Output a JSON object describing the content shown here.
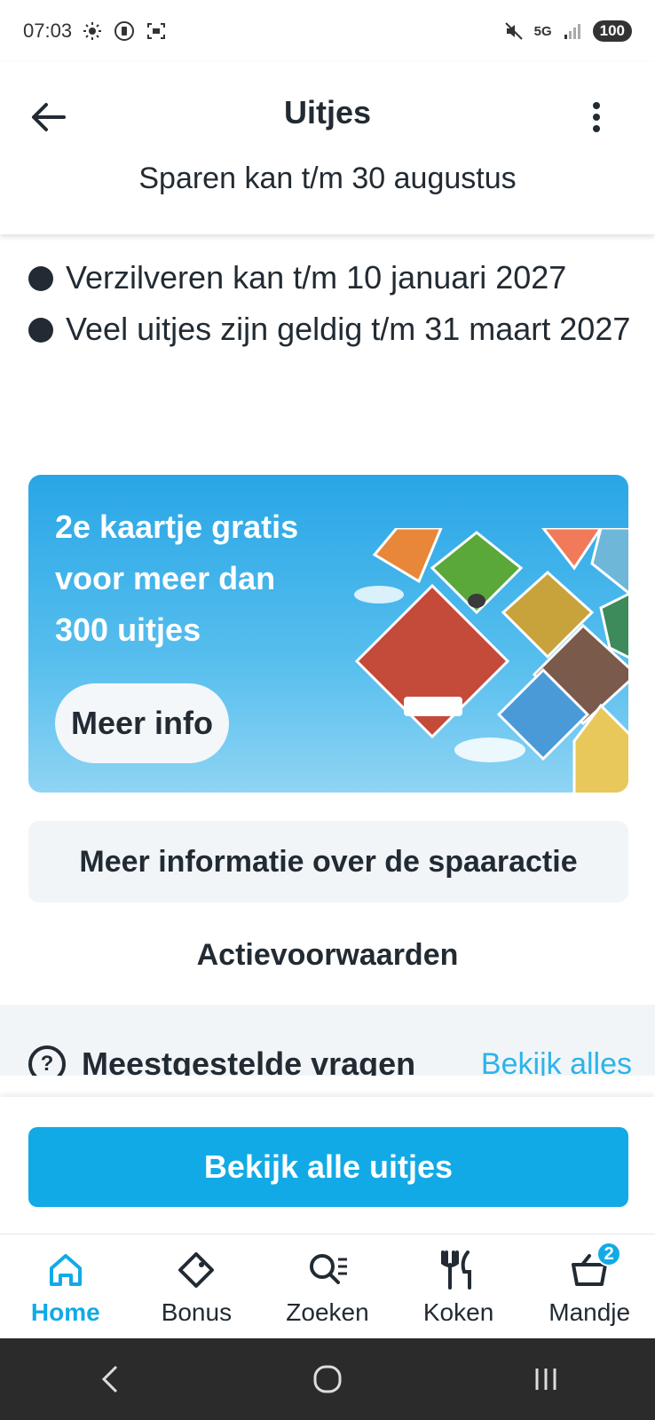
{
  "status_bar": {
    "time": "07:03",
    "network": "5G",
    "battery": "100"
  },
  "header": {
    "title": "Uitjes",
    "subtitle": "Sparen kan t/m 30 augustus"
  },
  "content": {
    "bullets": [
      "Verzilveren kan t/m 10 januari 2027",
      "Veel uitjes zijn geldig t/m 31 maart 2027"
    ],
    "promo": {
      "lines": [
        "2e kaartje gratis",
        "voor meer dan",
        "300 uitjes"
      ],
      "button_label": "Meer info",
      "colors": {
        "background_top": "#29a6e6",
        "background_bottom": "#8fd4f4"
      }
    },
    "info_button_label": "Meer informatie over de spaaractie",
    "terms_label": "Actievoorwaarden",
    "faq": {
      "title": "Meestgestelde vragen",
      "link": "Bekijk alles",
      "icon": "question-circle-icon"
    }
  },
  "cta": {
    "label": "Bekijk alle uitjes",
    "color": "#12aae6"
  },
  "bottom_nav": {
    "items": [
      {
        "label": "Home",
        "icon": "home-icon",
        "active": true
      },
      {
        "label": "Bonus",
        "icon": "tag-icon",
        "active": false
      },
      {
        "label": "Zoeken",
        "icon": "search-list-icon",
        "active": false
      },
      {
        "label": "Koken",
        "icon": "cutlery-icon",
        "active": false
      },
      {
        "label": "Mandje",
        "icon": "basket-icon",
        "active": false,
        "badge": "2"
      }
    ]
  },
  "accent_color": "#12aae6"
}
